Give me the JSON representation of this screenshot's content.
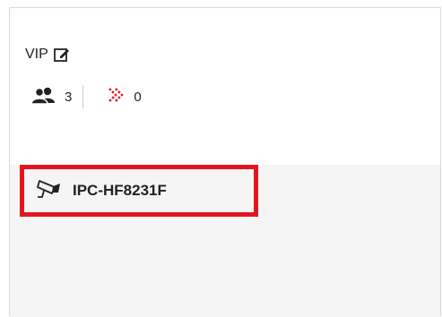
{
  "group": {
    "name": "VIP",
    "icons": {
      "edit": "edit-icon",
      "people": "people-icon",
      "alarm": "alarm-arrows-icon"
    },
    "person_count": "3",
    "alarm_count": "0"
  },
  "devices": [
    {
      "name": "IPC-HF8231F",
      "icon": "camera-icon",
      "highlighted": true
    }
  ],
  "colors": {
    "highlight": "#e3161f",
    "alarm_icon": "#e3161f",
    "device_area_bg": "#f5f5f5"
  }
}
